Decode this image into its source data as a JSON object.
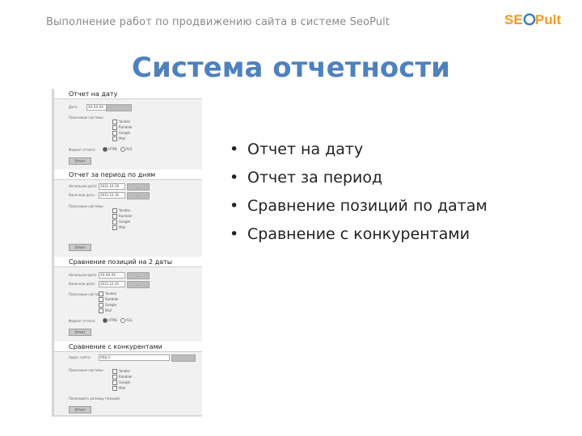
{
  "header": {
    "text": "Выполнение работ по продвижению сайта в системе SeoPult",
    "logo_text": "SEOPult",
    "logo_colors": {
      "orange": "#f29a1f",
      "blue": "#3a7ebf"
    }
  },
  "slide": {
    "title": "Система отчетности",
    "title_color": "#4f81bd",
    "bullets": [
      "Отчет на дату",
      "Отчет за период",
      "Сравнение позиций по датам",
      "Сравнение с конкурентами"
    ]
  },
  "screenshot": {
    "sections": [
      {
        "title": "Отчет на дату",
        "date_label": "Дата:",
        "date_value": "ХХ.ХХ.ХХ",
        "engines_label": "Поисковые системы:",
        "engines": [
          "Yandex",
          "Rambler",
          "Google",
          "Mail"
        ],
        "format_label": "Формат отчета:",
        "format_options": [
          "HTML",
          "XLS"
        ],
        "submit": "Отчет"
      },
      {
        "title": "Отчет за период по дням",
        "from_label": "Начальная дата:",
        "from_value": "2011.10.19",
        "to_label": "Конечная дата:",
        "to_value": "2011.12.10",
        "pick_button": "...",
        "engines_label": "Поисковые системы:",
        "engines": [
          "Yandex",
          "Rambler",
          "Google",
          "Mail"
        ],
        "submit": "Отчет"
      },
      {
        "title": "Сравнение позиций на 2 даты",
        "from_label": "Начальная дата:",
        "from_value": "ХХ.ХХ.ХХ",
        "to_label": "Конечная дата:",
        "to_value": "2011.12.10",
        "pick_button": "...",
        "engines_label": "Поисковые системы:",
        "engines": [
          "Yandex",
          "Rambler",
          "Google",
          "Mail"
        ],
        "format_label": "Формат отчета:",
        "format_options": [
          "HTML",
          "XLS"
        ],
        "submit": "Отчет"
      },
      {
        "title": "Сравнение с конкурентами",
        "site_label": "Адрес сайта:",
        "site_value": "http://",
        "engines_label": "Поисковые системы:",
        "engines": [
          "Yandex",
          "Rambler",
          "Google",
          "Mail"
        ],
        "hint": "Показывать разницу позиций:",
        "submit": "Отчет"
      }
    ]
  }
}
